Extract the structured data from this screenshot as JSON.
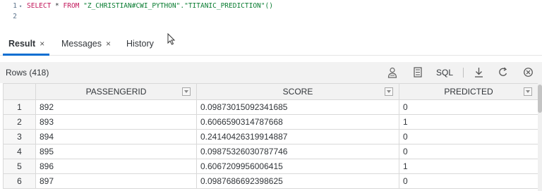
{
  "editor": {
    "lines": [
      {
        "number": "1",
        "keyword1": "SELECT",
        "mid": " * ",
        "keyword2": "FROM",
        "rest": " \"Z_CHRISTIAN#CWI_PYTHON\".\"TITANIC_PREDICTION\"()"
      },
      {
        "number": "2"
      }
    ]
  },
  "tabs": [
    {
      "label": "Result",
      "close": "×"
    },
    {
      "label": "Messages",
      "close": "×"
    },
    {
      "label": "History"
    }
  ],
  "toolbar": {
    "rows_label": "Rows (418)",
    "sql_label": "SQL"
  },
  "table": {
    "columns": [
      "PASSENGERID",
      "SCORE",
      "PREDICTED"
    ],
    "rows": [
      {
        "idx": "1",
        "passengerid": "892",
        "score": "0.09873015092341685",
        "predicted": "0"
      },
      {
        "idx": "2",
        "passengerid": "893",
        "score": "0.6066590314787668",
        "predicted": "1"
      },
      {
        "idx": "3",
        "passengerid": "894",
        "score": "0.24140426319914887",
        "predicted": "0"
      },
      {
        "idx": "4",
        "passengerid": "895",
        "score": "0.09875326030787746",
        "predicted": "0"
      },
      {
        "idx": "5",
        "passengerid": "896",
        "score": "0.6067209956006415",
        "predicted": "1"
      },
      {
        "idx": "6",
        "passengerid": "897",
        "score": "0.0987686692398625",
        "predicted": "0"
      }
    ]
  },
  "colors": {
    "accent": "#0a6ed1",
    "keyword": "#c2185b",
    "string": "#0a7d32"
  }
}
